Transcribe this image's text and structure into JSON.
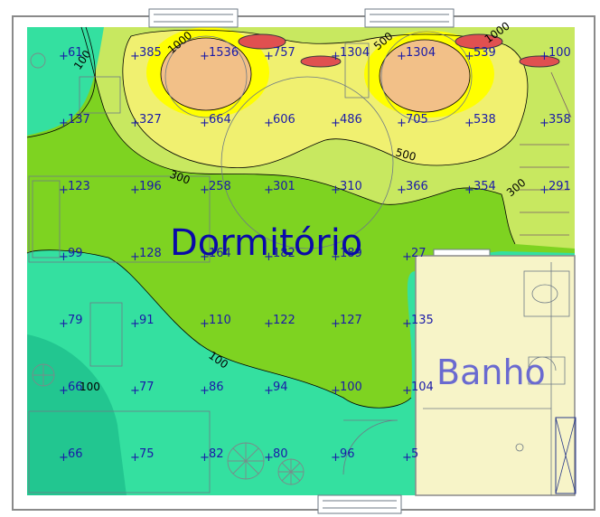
{
  "rooms": {
    "dormitorio": "Dormitório",
    "banho": "Banho"
  },
  "colors": {
    "background": "#ffffff",
    "wall": "#8a8a8a",
    "level_lowest": "#22c690",
    "level_low": "#34e0a0",
    "level_mid": "#7ed321",
    "level_upper": "#c8e860",
    "level_high": "#f0f070",
    "level_peak": "#ffff00",
    "level_max": "#f2c088",
    "bath_floor": "#f7f4c8",
    "label_text": "#1a1aa8",
    "banho_text": "#6a6ad0",
    "dormitorio_text": "#0a0aa8"
  },
  "isolines": [
    {
      "label": "100"
    },
    {
      "label": "1000"
    },
    {
      "label": "500"
    },
    {
      "label": "1000"
    },
    {
      "label": "500"
    },
    {
      "label": "300"
    },
    {
      "label": "300"
    },
    {
      "label": "100"
    },
    {
      "label": "100"
    }
  ],
  "values": [
    {
      "text": "61"
    },
    {
      "text": "385"
    },
    {
      "text": "1536"
    },
    {
      "text": "757"
    },
    {
      "text": "1304"
    },
    {
      "text": "1304"
    },
    {
      "text": "539"
    },
    {
      "text": "100"
    },
    {
      "text": "137"
    },
    {
      "text": "327"
    },
    {
      "text": "664"
    },
    {
      "text": "606"
    },
    {
      "text": "486"
    },
    {
      "text": "705"
    },
    {
      "text": "538"
    },
    {
      "text": "358"
    },
    {
      "text": "123"
    },
    {
      "text": "196"
    },
    {
      "text": "258"
    },
    {
      "text": "301"
    },
    {
      "text": "310"
    },
    {
      "text": "366"
    },
    {
      "text": "354"
    },
    {
      "text": "291"
    },
    {
      "text": "99"
    },
    {
      "text": "128"
    },
    {
      "text": "164"
    },
    {
      "text": "182"
    },
    {
      "text": "189"
    },
    {
      "text": "27"
    },
    {
      "text": "79"
    },
    {
      "text": "91"
    },
    {
      "text": "110"
    },
    {
      "text": "122"
    },
    {
      "text": "127"
    },
    {
      "text": "135"
    },
    {
      "text": "66"
    },
    {
      "text": "77"
    },
    {
      "text": "86"
    },
    {
      "text": "94"
    },
    {
      "text": "100"
    },
    {
      "text": "104"
    },
    {
      "text": "66"
    },
    {
      "text": "75"
    },
    {
      "text": "82"
    },
    {
      "text": "80"
    },
    {
      "text": "96"
    },
    {
      "text": "5"
    }
  ]
}
